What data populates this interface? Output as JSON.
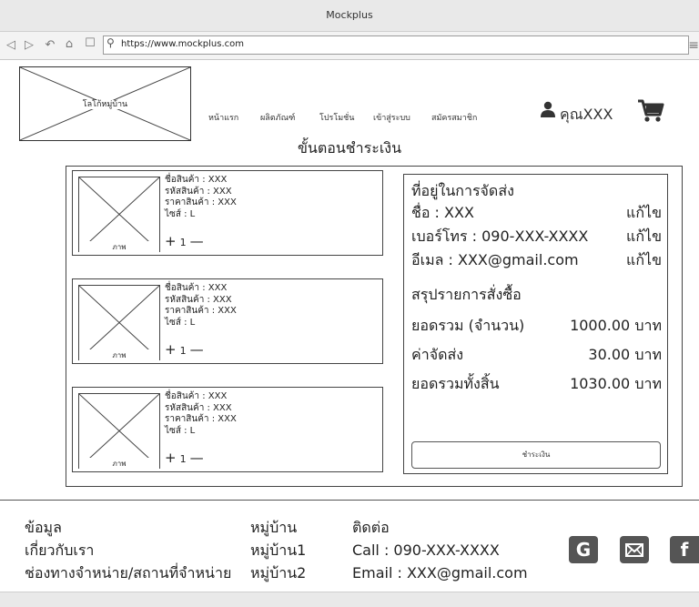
{
  "window": {
    "title": "Mockplus"
  },
  "browser": {
    "url": "https://www.mockplus.com"
  },
  "header": {
    "logo_label": "โลโก้หมู่บ้าน",
    "nav": [
      "หน้าแรก",
      "ผลิตภัณฑ์",
      "โปรโมชั่น",
      "เข้าสู่ระบบ",
      "สมัครสมาชิก"
    ],
    "username": "คุณXXX"
  },
  "page": {
    "title": "ขั้นตอนชำระเงิน"
  },
  "products": [
    {
      "image_label": "ภาพ",
      "name": "ชื่อสินค้า : XXX",
      "code": "รหัสสินค้า : XXX",
      "price": "ราคาสินค้า : XXX",
      "size": "ไซส์ : L",
      "plus": "+",
      "qty": "1",
      "minus": "—"
    },
    {
      "image_label": "ภาพ",
      "name": "ชื่อสินค้า : XXX",
      "code": "รหัสสินค้า : XXX",
      "price": "ราคาสินค้า : XXX",
      "size": "ไซส์ : L",
      "plus": "+",
      "qty": "1",
      "minus": "—"
    },
    {
      "image_label": "ภาพ",
      "name": "ชื่อสินค้า : XXX",
      "code": "รหัสสินค้า : XXX",
      "price": "ราคาสินค้า : XXX",
      "size": "ไซส์ : L",
      "plus": "+",
      "qty": "1",
      "minus": "—"
    }
  ],
  "shipping": {
    "heading": "ที่อยู่ในการจัดส่ง",
    "name": "ชื่อ : XXX",
    "phone": "เบอร์โทร : 090-XXX-XXXX",
    "email": "อีเมล : XXX@gmail.com",
    "edit_label": "แก้ไข"
  },
  "order": {
    "heading": "สรุปรายการสั่งซื้อ",
    "subtotal_label": "ยอดรวม (จำนวน)",
    "subtotal_value": "1000.00 บาท",
    "shipping_label": "ค่าจัดส่ง",
    "shipping_value": "30.00 บาท",
    "total_label": "ยอดรวมทั้งสิ้น",
    "total_value": "1030.00 บาท",
    "pay_button": "ชำระเงิน"
  },
  "footer": {
    "info": [
      "ข้อมูล",
      "เกี่ยวกับเรา",
      "ช่องทางจำหน่าย/สถานที่จำหน่าย"
    ],
    "village": [
      "หมู่บ้าน",
      "หมู่บ้าน1",
      "หมู่บ้าน2"
    ],
    "contact": [
      "ติดต่อ",
      "Call : 090-XXX-XXXX",
      "Email : XXX@gmail.com"
    ],
    "social_icons": [
      "google-icon",
      "mail-icon",
      "facebook-icon"
    ]
  }
}
